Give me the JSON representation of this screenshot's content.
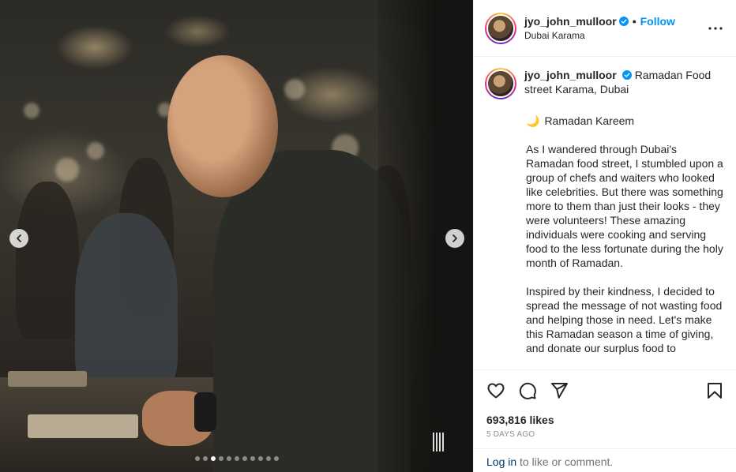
{
  "post": {
    "username": "jyo_john_mulloor",
    "location": "Dubai Karama",
    "follow_label": "Follow",
    "separator": "•",
    "caption_lead": "Ramadan Food street Karama, Dubai",
    "greeting": "Ramadan Kareem",
    "greeting_emoji": "🌙",
    "paragraph_1": "As I wandered through Dubai's Ramadan food street, I stumbled upon a group of chefs and waiters who looked like celebrities. But there was something more to them than just their looks - they were volunteers! These amazing individuals were cooking and serving food to the less fortunate during the holy month of Ramadan.",
    "paragraph_2": "Inspired by their kindness, I decided to spread the message of not wasting food and helping those in need. Let's make this Ramadan season a time of giving, and donate our surplus food to",
    "likes": "693,816 likes",
    "date": "5 DAYS AGO",
    "login_link": "Log in",
    "login_rest": " to like or comment."
  },
  "carousel": {
    "total_slides": 11,
    "active_index": 2
  },
  "icons": {
    "prev": "chevron-left-icon",
    "next": "chevron-right-icon",
    "more": "more-options-icon",
    "verified": "verified-badge-icon",
    "like": "heart-icon",
    "comment": "comment-icon",
    "share": "share-icon",
    "save": "bookmark-icon"
  },
  "colors": {
    "follow": "#0095f6",
    "verified": "#0095f6",
    "muted": "#8e8e8e",
    "link": "#00376b"
  }
}
